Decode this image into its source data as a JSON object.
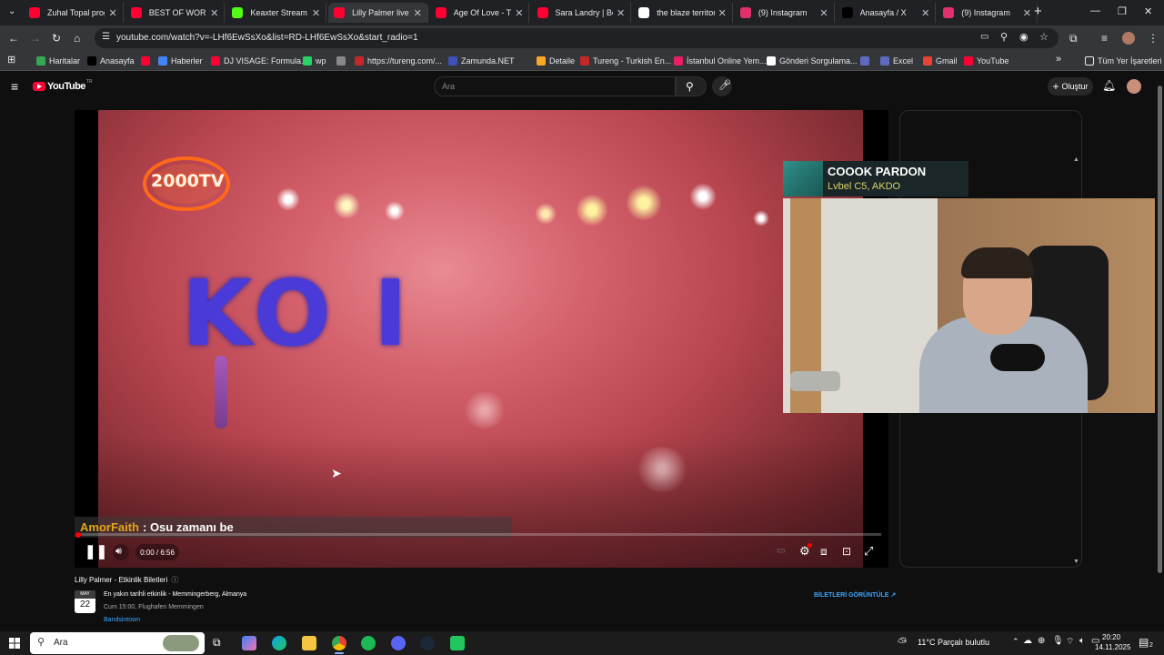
{
  "browser": {
    "tabs": [
      {
        "title": "Zuhal Topal prog",
        "color": "#ff0033",
        "active": false
      },
      {
        "title": "BEST OF WORLD",
        "color": "#ff0033",
        "active": false
      },
      {
        "title": "Keaxter Stream -",
        "color": "#53fc18",
        "active": false
      },
      {
        "title": "Lilly Palmer live in",
        "color": "#ff0033",
        "active": true
      },
      {
        "title": "Age Of Love - The",
        "color": "#ff0033",
        "active": false
      },
      {
        "title": "Sara Landry | Boil",
        "color": "#ff0033",
        "active": false
      },
      {
        "title": "the blaze territory",
        "color": "#ffffff",
        "active": false
      },
      {
        "title": "(9) Instagram",
        "color": "#e1306c",
        "active": false
      },
      {
        "title": "Anasayfa / X",
        "color": "#000000",
        "active": false
      },
      {
        "title": "(9) Instagram",
        "color": "#e1306c",
        "active": false
      }
    ],
    "new_tab": "+",
    "url": "youtube.com/watch?v=-LHf6EwSsXo&list=RD-LHf6EwSsXo&start_radio=1",
    "bookmarks": [
      {
        "label": "Haritalar",
        "color": "#34a853"
      },
      {
        "label": "Anasayfa",
        "color": "#000000"
      },
      {
        "label": "",
        "color": "#ff0033"
      },
      {
        "label": "Haberler",
        "color": "#4285f4"
      },
      {
        "label": "DJ VISAGE: Formula...",
        "color": "#ff0033"
      },
      {
        "label": "wp",
        "color": "#25d366"
      },
      {
        "label": "",
        "color": "#888888"
      },
      {
        "label": "https://tureng.com/...",
        "color": "#c62828"
      },
      {
        "label": "Zamunda.NET",
        "color": "#3f51b5"
      },
      {
        "label": "Detaile",
        "color": "#f9a825"
      },
      {
        "label": "Tureng - Turkish En...",
        "color": "#c62828"
      },
      {
        "label": "İstanbul Online Yem...",
        "color": "#e91e63"
      },
      {
        "label": "Gönderi Sorgulama...",
        "color": "#ffffff"
      },
      {
        "label": "",
        "color": "#5c6bc0"
      },
      {
        "label": "Excel",
        "color": "#5c6bc0"
      },
      {
        "label": "Gmail",
        "color": "#ea4335"
      },
      {
        "label": "YouTube",
        "color": "#ff0033"
      }
    ],
    "all_bookmarks": "Tüm Yer İşaretleri"
  },
  "youtube": {
    "logo_text": "YouTube",
    "region": "TR",
    "search_placeholder": "Ara",
    "create_label": "Oluştur"
  },
  "player": {
    "channel_logo": "2000TV",
    "stage_text": "KO I",
    "time": "0:00 / 6:56",
    "progress_fraction": 0.004
  },
  "chat": {
    "user": "AmorFaith",
    "message": ": Osu zamanı be"
  },
  "now_playing": {
    "title": "COOOK PARDON",
    "artist": "Lvbel C5, AKDO"
  },
  "below_video": {
    "events_title": "Lilly Palmer - Etkinlik Biletleri",
    "month": "MAY",
    "day": "22",
    "event_title": "En yakın tarihli etkinlik - Memmingerberg, Almanya",
    "event_detail": "Cum 15:00, Flughafen Memmingen",
    "provider": "Bandsintown",
    "tickets_link": "BİLETLERİ GÖRÜNTÜLE ↗"
  },
  "taskbar": {
    "search_placeholder": "Ara",
    "weather": "11°C  Parçalı bulutlu",
    "time": "20:20",
    "date": "14.11.2025",
    "notif_count": "2"
  }
}
